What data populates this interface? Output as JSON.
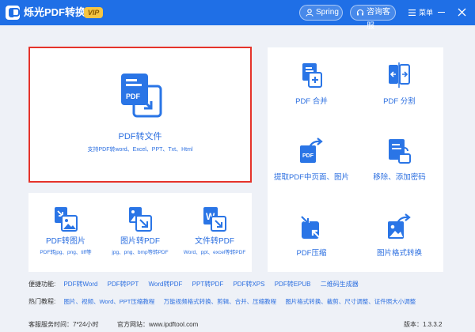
{
  "app": {
    "title": "烁光PDF转换器",
    "vip_badge": "VIP",
    "user_name": "Spring",
    "service_label": "咨询客服",
    "menu_label": "菜单"
  },
  "colors": {
    "titlebar": "#1f6fe6",
    "accent": "#2c6fe0",
    "highlight_border": "#e5332a",
    "vip": "#f5c542"
  },
  "main_card": {
    "title": "PDF转文件",
    "subtitle": "支持PDF转word、Excel、PPT、Txt、Html",
    "icon": "pdf-convert-icon",
    "icon_text": "PDF"
  },
  "right_tiles": [
    {
      "label": "PDF 合并",
      "icon": "pdf-merge-icon"
    },
    {
      "label": "PDF 分割",
      "icon": "pdf-split-icon"
    },
    {
      "label": "提取PDF中页面、图片",
      "icon": "pdf-extract-icon",
      "icon_text": "PDF"
    },
    {
      "label": "移除、添加密码",
      "icon": "pdf-password-icon"
    },
    {
      "label": "PDF压缩",
      "icon": "pdf-compress-icon"
    },
    {
      "label": "图片格式转换",
      "icon": "image-format-icon"
    }
  ],
  "bottom_tiles": [
    {
      "label": "PDF转图片",
      "sub": "PDF转jpg、png、tiff等",
      "icon": "pdf-to-image-icon"
    },
    {
      "label": "图片转PDF",
      "sub": "jpg、png、bmp等转PDF",
      "icon": "image-to-pdf-icon"
    },
    {
      "label": "文件转PDF",
      "sub": "Word、ppt、excel等转PDF",
      "icon": "file-to-pdf-icon",
      "icon_text": "W"
    }
  ],
  "quick_links": {
    "label": "便捷功能:",
    "items": [
      "PDF转Word",
      "PDF转PPT",
      "Word转PDF",
      "PPT转PDF",
      "PDF转XPS",
      "PDF转EPUB",
      "二维码生成器"
    ]
  },
  "tutorials": {
    "label": "热门教程:",
    "items": [
      "图片、视频、Word、PPT压缩教程",
      "万能视频格式转换、剪辑、合并、压缩教程",
      "图片格式转换、裁剪、尺寸调整、证件照大小调整"
    ]
  },
  "footer": {
    "service_hours": "客服服务时间：7*24小时",
    "website": "官方网站：www.ipdftool.com",
    "version": "版本：1.3.3.2"
  }
}
